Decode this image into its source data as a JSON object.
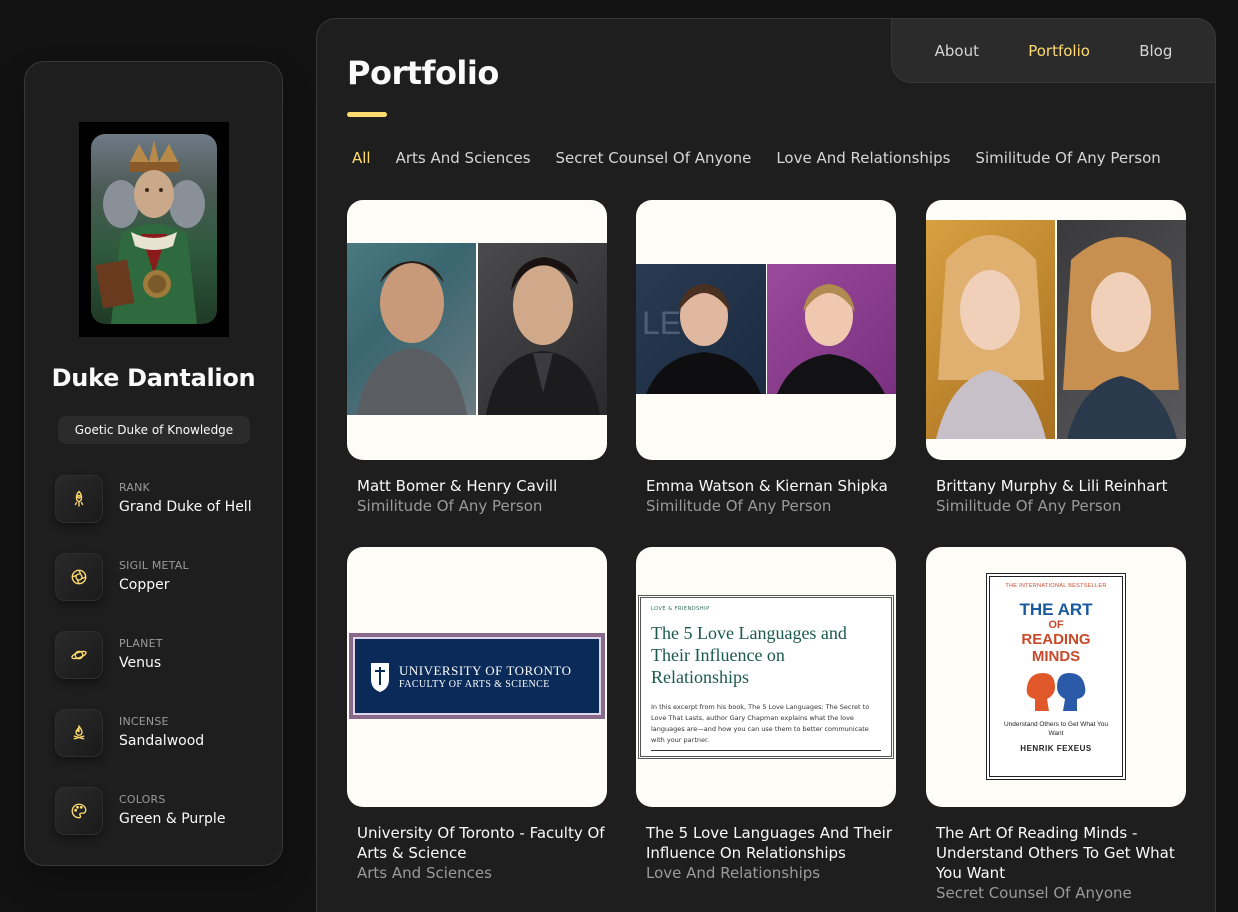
{
  "sidebar": {
    "name": "Duke Dantalion",
    "title": "Goetic Duke of Knowledge",
    "items": [
      {
        "label": "RANK",
        "value": "Grand Duke of Hell",
        "icon": "rocket-icon"
      },
      {
        "label": "SIGIL METAL",
        "value": "Copper",
        "icon": "aperture-icon"
      },
      {
        "label": "PLANET",
        "value": "Venus",
        "icon": "planet-icon"
      },
      {
        "label": "INCENSE",
        "value": "Sandalwood",
        "icon": "bonfire-icon"
      },
      {
        "label": "COLORS",
        "value": "Green & Purple",
        "icon": "palette-icon"
      }
    ]
  },
  "nav": {
    "items": [
      {
        "label": "About"
      },
      {
        "label": "Portfolio"
      },
      {
        "label": "Blog"
      }
    ],
    "active": "Portfolio"
  },
  "page": {
    "title": "Portfolio"
  },
  "filters": {
    "items": [
      "All",
      "Arts And Sciences",
      "Secret Counsel Of Anyone",
      "Love And Relationships",
      "Similitude Of Any Person"
    ],
    "active": "All"
  },
  "projects": [
    {
      "title": "Matt Bomer & Henry Cavill",
      "category": "Similitude Of Any Person"
    },
    {
      "title": "Emma Watson & Kiernan Shipka",
      "category": "Similitude Of Any Person"
    },
    {
      "title": "Brittany Murphy & Lili Reinhart",
      "category": "Similitude Of Any Person"
    },
    {
      "title": "University Of Toronto - Faculty Of Arts & Science",
      "category": "Arts And Sciences",
      "image_text": {
        "line1": "UNIVERSITY OF TORONTO",
        "line2": "FACULTY OF ARTS & SCIENCE"
      }
    },
    {
      "title": "The 5 Love Languages And Their Influence On Relationships",
      "category": "Love And Relationships",
      "image_text": {
        "kicker": "LOVE & FRIENDSHIP",
        "headline": "The 5 Love Languages and Their Influence on Relationships",
        "body": "In this excerpt from his book, The 5 Love Languages: The Secret to Love That Lasts, author Gary Chapman explains what the love languages are—and how you can use them to better communicate with your partner."
      }
    },
    {
      "title": "The Art Of Reading Minds - Understand Others To Get What You Want",
      "category": "Secret Counsel Of Anyone",
      "image_text": {
        "top": "THE INTERNATIONAL BESTSELLER",
        "title1": "THE ART",
        "title2": "OF",
        "title3": "READING",
        "title4": "MINDS",
        "subtitle": "Understand Others to Get What You Want",
        "author": "HENRIK FEXEUS"
      }
    }
  ],
  "colors": {
    "accent": "#ffdb70",
    "background": "#121212",
    "panel": "#1e1e1f",
    "card": "#fdfcf6"
  }
}
